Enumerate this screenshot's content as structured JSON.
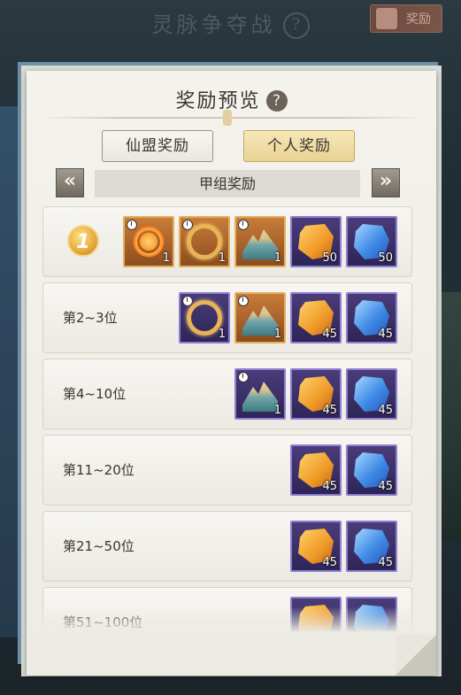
{
  "header": {
    "title": "灵脉争夺战",
    "help": "?",
    "reward_button": "奖励"
  },
  "panel": {
    "title": "奖励预览",
    "help": "?",
    "tabs": [
      {
        "label": "仙盟奖励",
        "selected": false
      },
      {
        "label": "个人奖励",
        "selected": true
      }
    ],
    "group": {
      "label": "甲组奖励",
      "prev": "«",
      "next": "»"
    },
    "rows": [
      {
        "rank": "1",
        "items": [
          {
            "icon": "fire-ring-icon",
            "qty": "1",
            "frame": "orange",
            "timed": true
          },
          {
            "icon": "golden-ring-icon",
            "qty": "1",
            "frame": "orange",
            "timed": true
          },
          {
            "icon": "landscape-scene-icon",
            "qty": "1",
            "frame": "orange",
            "timed": true
          },
          {
            "icon": "gold-spirit-stone-icon",
            "qty": "50",
            "frame": "purple",
            "timed": false
          },
          {
            "icon": "blue-spirit-stone-icon",
            "qty": "50",
            "frame": "purple",
            "timed": false
          }
        ]
      },
      {
        "rank": "第2~3位",
        "items": [
          {
            "icon": "golden-ring-icon",
            "qty": "1",
            "frame": "purple",
            "timed": true
          },
          {
            "icon": "landscape-scene-icon",
            "qty": "1",
            "frame": "orange",
            "timed": true
          },
          {
            "icon": "gold-spirit-stone-icon",
            "qty": "45",
            "frame": "purple",
            "timed": false
          },
          {
            "icon": "blue-spirit-stone-icon",
            "qty": "45",
            "frame": "purple",
            "timed": false
          }
        ]
      },
      {
        "rank": "第4~10位",
        "items": [
          {
            "icon": "landscape-scene-icon",
            "qty": "1",
            "frame": "purple",
            "timed": true
          },
          {
            "icon": "gold-spirit-stone-icon",
            "qty": "45",
            "frame": "purple",
            "timed": false
          },
          {
            "icon": "blue-spirit-stone-icon",
            "qty": "45",
            "frame": "purple",
            "timed": false
          }
        ]
      },
      {
        "rank": "第11~20位",
        "items": [
          {
            "icon": "gold-spirit-stone-icon",
            "qty": "45",
            "frame": "purple",
            "timed": false
          },
          {
            "icon": "blue-spirit-stone-icon",
            "qty": "45",
            "frame": "purple",
            "timed": false
          }
        ]
      },
      {
        "rank": "第21~50位",
        "items": [
          {
            "icon": "gold-spirit-stone-icon",
            "qty": "45",
            "frame": "purple",
            "timed": false
          },
          {
            "icon": "blue-spirit-stone-icon",
            "qty": "45",
            "frame": "purple",
            "timed": false
          }
        ]
      },
      {
        "rank": "第51~100位",
        "items": [
          {
            "icon": "gold-spirit-stone-icon",
            "qty": "",
            "frame": "purple",
            "timed": false
          },
          {
            "icon": "blue-spirit-stone-icon",
            "qty": "",
            "frame": "purple",
            "timed": false
          }
        ]
      }
    ]
  }
}
